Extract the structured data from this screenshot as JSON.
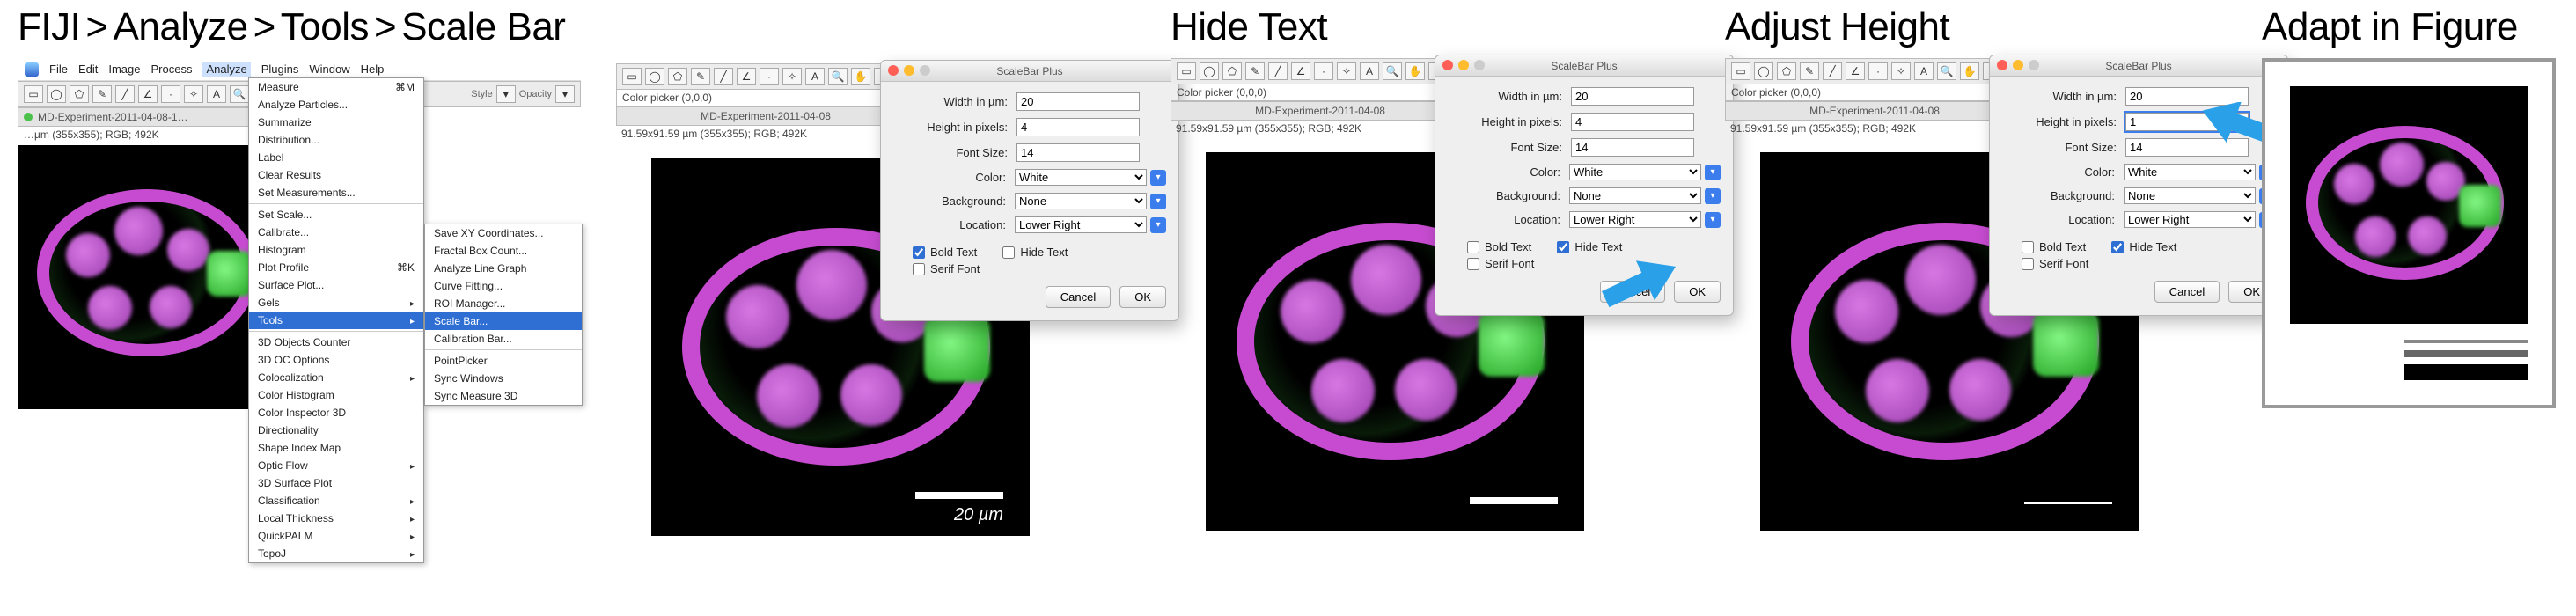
{
  "panel1": {
    "heading_parts": [
      "FIJI",
      "Analyze",
      "Tools",
      "Scale Bar"
    ],
    "menubar": [
      "File",
      "Edit",
      "Image",
      "Process",
      "Analyze",
      "Plugins",
      "Window",
      "Help"
    ],
    "tool_icons": [
      "rect",
      "oval",
      "poly",
      "free",
      "line",
      "angle",
      "point",
      "wand",
      "text",
      "zoom",
      "hand",
      "dropper",
      "dev",
      "stk",
      "lut"
    ],
    "toolstrip_right": {
      "style_label": "Style",
      "opacity_label": "Opacity"
    },
    "image_title": "MD-Experiment-2011-04-08-1…",
    "status": "…µm (355x355); RGB; 492K",
    "menu_analyze": [
      {
        "t": "Measure",
        "acc": "⌘M"
      },
      {
        "t": "Analyze Particles..."
      },
      {
        "t": "Summarize"
      },
      {
        "t": "Distribution..."
      },
      {
        "t": "Label"
      },
      {
        "t": "Clear Results"
      },
      {
        "t": "Set Measurements..."
      }
    ],
    "menu_analyze2": [
      {
        "t": "Set Scale..."
      },
      {
        "t": "Calibrate..."
      },
      {
        "t": "Histogram"
      },
      {
        "t": "Plot Profile",
        "acc": "⌘K"
      },
      {
        "t": "Surface Plot..."
      },
      {
        "t": "Gels",
        "sub": true
      },
      {
        "t": "Tools",
        "sub": true,
        "hl": true
      }
    ],
    "menu_analyze3": [
      {
        "t": "3D Objects Counter"
      },
      {
        "t": "3D OC Options"
      },
      {
        "t": "Colocalization",
        "sub": true
      },
      {
        "t": "Color Histogram"
      },
      {
        "t": "Color Inspector 3D"
      },
      {
        "t": "Directionality"
      },
      {
        "t": "Shape Index Map"
      },
      {
        "t": "Optic Flow",
        "sub": true
      },
      {
        "t": "3D Surface Plot"
      },
      {
        "t": "Classification",
        "sub": true
      },
      {
        "t": "Local Thickness",
        "sub": true
      },
      {
        "t": "QuickPALM",
        "sub": true
      },
      {
        "t": "TopoJ",
        "sub": true
      }
    ],
    "menu_tools": [
      {
        "t": "Save XY Coordinates..."
      },
      {
        "t": "Fractal Box Count..."
      },
      {
        "t": "Analyze Line Graph"
      },
      {
        "t": "Curve Fitting..."
      },
      {
        "t": "ROI Manager..."
      },
      {
        "t": "Scale Bar...",
        "hl": true
      },
      {
        "t": "Calibration Bar..."
      }
    ],
    "menu_tools2": [
      {
        "t": "PointPicker"
      },
      {
        "t": "Sync Windows"
      },
      {
        "t": "Sync Measure 3D"
      }
    ]
  },
  "dialog": {
    "title": "ScaleBar Plus",
    "labels": {
      "width": "Width in µm:",
      "height": "Height in pixels:",
      "font": "Font Size:",
      "color": "Color:",
      "bg": "Background:",
      "loc": "Location:"
    },
    "options": {
      "color": "White",
      "bg": "None",
      "loc": "Lower Right"
    },
    "checks": {
      "bold": "Bold Text",
      "hide": "Hide Text",
      "serif": "Serif Font"
    },
    "btn_cancel": "Cancel",
    "btn_ok": "OK"
  },
  "panel2": {
    "heading": " ",
    "status": "91.59x91.59 µm (355x355); RGB; 492K",
    "image_title": "MD-Experiment-2011-04-08",
    "toolstrip_label": "Color picker (0,0,0)",
    "dlg_values": {
      "width": "20",
      "height": "4",
      "font": "14",
      "bold": true,
      "hide": false
    },
    "scale_text": "20 µm"
  },
  "panel3": {
    "heading": "Hide Text",
    "status": "91.59x91.59 µm (355x355); RGB; 492K",
    "image_title": "MD-Experiment-2011-04-08",
    "toolstrip_label": "Color picker (0,0,0)",
    "dlg_values": {
      "width": "20",
      "height": "4",
      "font": "14",
      "bold": false,
      "hide": true
    }
  },
  "panel4": {
    "heading": "Adjust Height",
    "status": "91.59x91.59 µm (355x355); RGB; 492K",
    "image_title": "MD-Experiment-2011-04-08",
    "toolstrip_label": "Color picker (0,0,0)",
    "dlg_values": {
      "width": "20",
      "height": "1",
      "font": "14",
      "bold": false,
      "hide": true
    }
  },
  "panel5": {
    "heading": "Adapt in Figure"
  }
}
